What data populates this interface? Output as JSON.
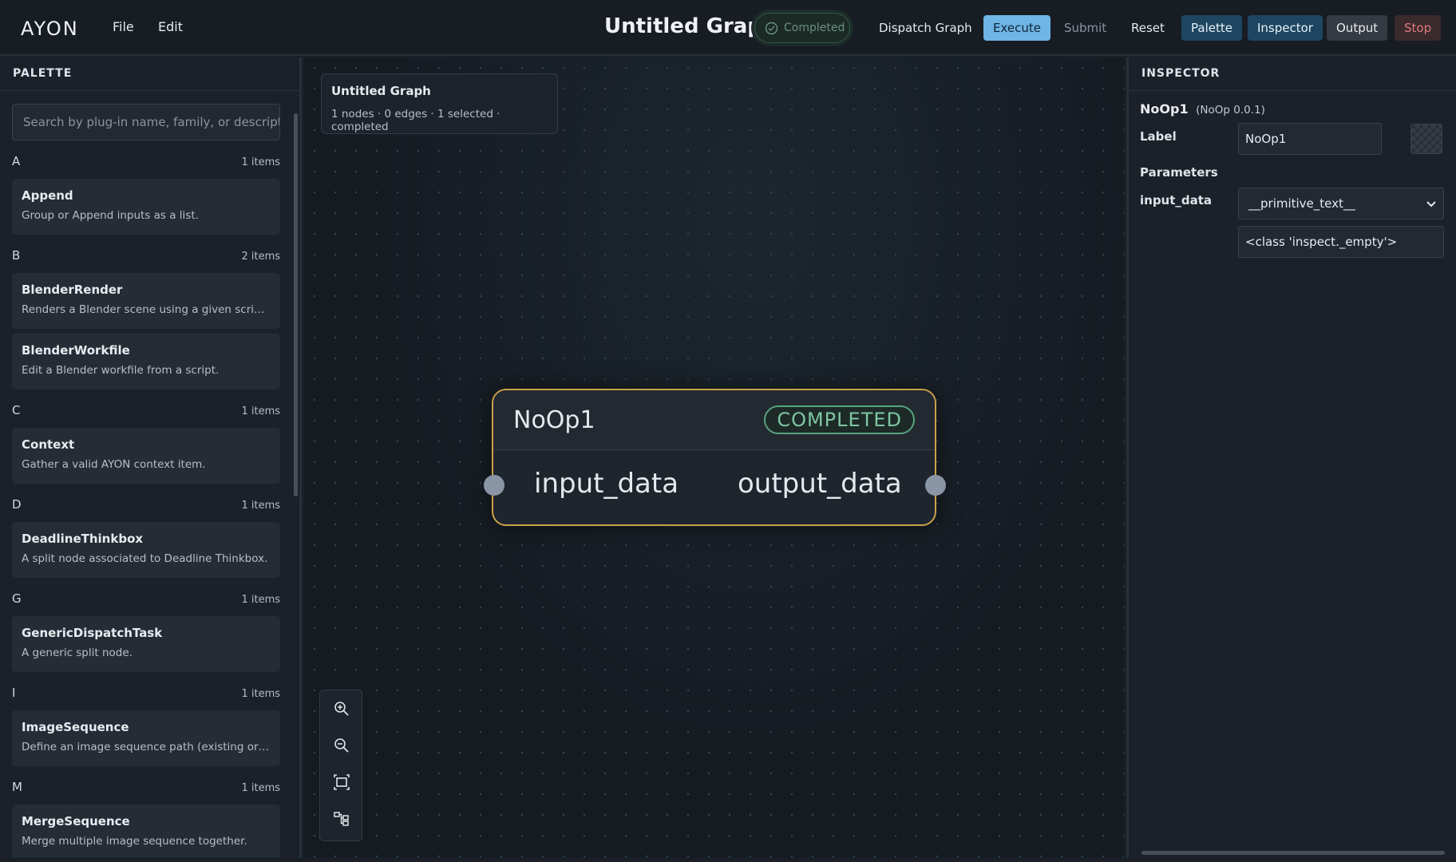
{
  "app": {
    "logo_text": "AYON",
    "menu": [
      "File",
      "Edit"
    ]
  },
  "header": {
    "title": "Untitled Graph",
    "status": "Completed",
    "buttons": {
      "dispatch": "Dispatch Graph",
      "execute": "Execute",
      "submit": "Submit",
      "reset": "Reset",
      "palette": "Palette",
      "inspector": "Inspector",
      "output": "Output",
      "stop": "Stop"
    }
  },
  "palette": {
    "header": "PALETTE",
    "search_placeholder": "Search by plug-in name, family, or description",
    "groups": [
      {
        "letter": "A",
        "count": "1 items",
        "items": [
          {
            "name": "Append",
            "desc": "Group or Append inputs as a list."
          }
        ]
      },
      {
        "letter": "B",
        "count": "2 items",
        "items": [
          {
            "name": "BlenderRender",
            "desc": "Renders a Blender scene using a given script a..."
          },
          {
            "name": "BlenderWorkfile",
            "desc": "Edit a Blender workfile from a script."
          }
        ]
      },
      {
        "letter": "C",
        "count": "1 items",
        "items": [
          {
            "name": "Context",
            "desc": "Gather a valid AYON context item."
          }
        ]
      },
      {
        "letter": "D",
        "count": "1 items",
        "items": [
          {
            "name": "DeadlineThinkbox",
            "desc": "A split node associated to Deadline Thinkbox."
          }
        ]
      },
      {
        "letter": "G",
        "count": "1 items",
        "items": [
          {
            "name": "GenericDispatchTask",
            "desc": "A generic split node."
          }
        ]
      },
      {
        "letter": "I",
        "count": "1 items",
        "items": [
          {
            "name": "ImageSequence",
            "desc": "Define an image sequence path (existing or no..."
          }
        ]
      },
      {
        "letter": "M",
        "count": "1 items",
        "items": [
          {
            "name": "MergeSequence",
            "desc": "Merge multiple image sequence together."
          }
        ]
      }
    ]
  },
  "canvas": {
    "info_title": "Untitled Graph",
    "info_summary": "1 nodes · 0 edges · 1 selected · completed",
    "node": {
      "title": "NoOp1",
      "status": "COMPLETED",
      "input": "input_data",
      "output": "output_data"
    },
    "zoom_icons": [
      "zoom-in-icon",
      "zoom-out-icon",
      "fit-view-icon",
      "auto-layout-icon"
    ]
  },
  "inspector": {
    "header": "INSPECTOR",
    "node_name": "NoOp1",
    "node_version": "(NoOp 0.0.1)",
    "label_field": "Label",
    "label_value": "NoOp1",
    "parameters_heading": "Parameters",
    "param_name": "input_data",
    "param_type": "__primitive_text__",
    "param_value": "<class 'inspect._empty'>"
  },
  "colors": {
    "accent": "#6fb5e6",
    "node_border": "#c9a14a",
    "completed": "#58a37f",
    "stop": "#e07b7b"
  }
}
